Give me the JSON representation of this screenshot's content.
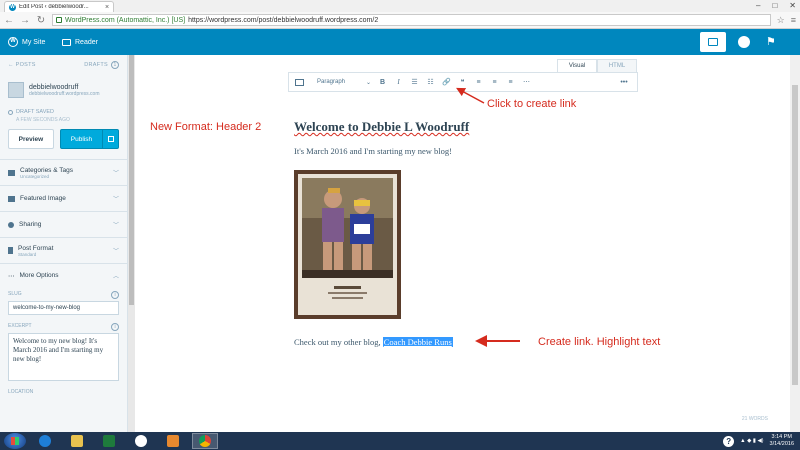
{
  "browser": {
    "tab_title": "Edit Post ‹ debbielwoodr...",
    "tab_close": "×",
    "window_controls": [
      "–",
      "□",
      "✕"
    ],
    "back": "←",
    "forward": "→",
    "reload": "↻",
    "ev_cert": "WordPress.com (Automattic, Inc.) [US]",
    "url": "https://wordpress.com/post/debbielwoodruff.wordpress.com/2",
    "star": "☆",
    "menu": "≡"
  },
  "masterbar": {
    "my_site": "My Site",
    "reader": "Reader"
  },
  "sidebar": {
    "back_label": "← POSTS",
    "drafts_label": "DRAFTS",
    "drafts_count": "1",
    "site_name": "debbielwoodruff",
    "site_domain": "debbielwoodruff.wordpress.com",
    "status": "DRAFT SAVED",
    "saved_time": "A FEW SECONDS AGO",
    "preview": "Preview",
    "publish": "Publish",
    "sections": [
      {
        "title": "Categories & Tags",
        "subtitle": "Uncategorized"
      },
      {
        "title": "Featured Image",
        "subtitle": ""
      },
      {
        "title": "Sharing",
        "subtitle": ""
      },
      {
        "title": "Post Format",
        "subtitle": "Standard"
      }
    ],
    "more_options": "More Options",
    "slug_label": "SLUG",
    "slug_value": "welcome-to-my-new-blog",
    "excerpt_label": "EXCERPT",
    "excerpt_value": "Welcome to my new blog! It's March 2016 and I'm starting my new blog!",
    "location_label": "LOCATION",
    "info_glyph": "i"
  },
  "editor": {
    "tab_visual": "Visual",
    "tab_html": "HTML",
    "paragraph": "Paragraph",
    "dropdown_glyph": "⌄",
    "toolbar_icons": {
      "bold": "B",
      "italic": "I",
      "bullets": "☰",
      "numbers": "☷",
      "link": "🔗",
      "quote": "❝",
      "align_left": "≡",
      "align_center": "≡",
      "align_right": "≡",
      "more": "⋯",
      "overflow": "•••"
    },
    "heading": "Welcome to Debbie L Woodruff",
    "para1": "It's March 2016 and I'm starting my new blog!",
    "para2_prefix": "Check out my other blog, ",
    "para2_link": "Coach Debbie Runs",
    "word_count": "21 WORDS",
    "photo_caption": "Houston Marathon"
  },
  "annotations": {
    "header": "New Format: Header 2",
    "link": "Click to create link",
    "highlight": "Create link. Highlight text"
  },
  "taskbar": {
    "time": "3:14 PM",
    "date": "3/14/2016",
    "help": "?"
  }
}
